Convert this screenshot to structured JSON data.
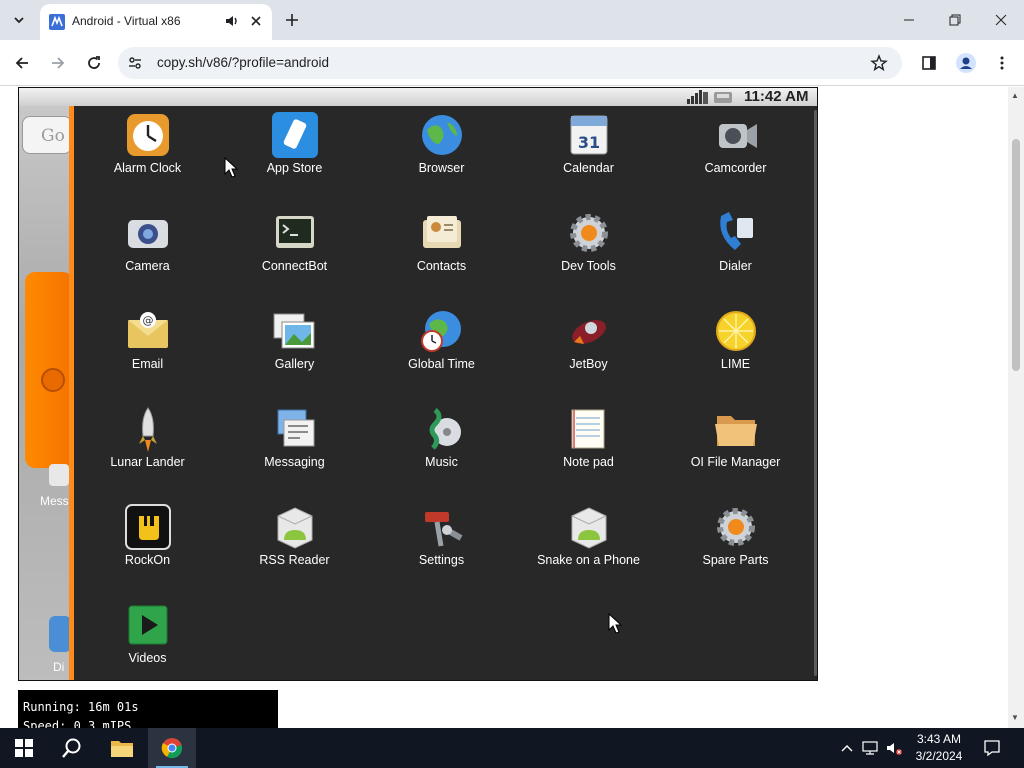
{
  "browser": {
    "tab_title": "Android - Virtual x86",
    "url": "copy.sh/v86/?profile=android"
  },
  "android": {
    "status_time": "11:42 AM",
    "home_search_hint": "Go",
    "home_label_messaging": "Mess",
    "home_label_dialer": "Di"
  },
  "apps": [
    {
      "label": "Alarm Clock",
      "icon": "alarm-clock-icon"
    },
    {
      "label": "App Store",
      "icon": "app-store-icon"
    },
    {
      "label": "Browser",
      "icon": "browser-globe-icon"
    },
    {
      "label": "Calendar",
      "icon": "calendar-icon"
    },
    {
      "label": "Camcorder",
      "icon": "camcorder-icon"
    },
    {
      "label": "Camera",
      "icon": "camera-icon"
    },
    {
      "label": "ConnectBot",
      "icon": "terminal-icon"
    },
    {
      "label": "Contacts",
      "icon": "contacts-icon"
    },
    {
      "label": "Dev Tools",
      "icon": "gear-icon"
    },
    {
      "label": "Dialer",
      "icon": "phone-icon"
    },
    {
      "label": "Email",
      "icon": "email-icon"
    },
    {
      "label": "Gallery",
      "icon": "gallery-icon"
    },
    {
      "label": "Global Time",
      "icon": "globe-clock-icon"
    },
    {
      "label": "JetBoy",
      "icon": "jetboy-icon"
    },
    {
      "label": "LIME",
      "icon": "lemon-icon"
    },
    {
      "label": "Lunar Lander",
      "icon": "rocket-icon"
    },
    {
      "label": "Messaging",
      "icon": "messaging-icon"
    },
    {
      "label": "Music",
      "icon": "music-icon"
    },
    {
      "label": "Note pad",
      "icon": "notepad-icon"
    },
    {
      "label": "OI File Manager",
      "icon": "folder-icon"
    },
    {
      "label": "RockOn",
      "icon": "rockon-icon"
    },
    {
      "label": "RSS Reader",
      "icon": "android-box-icon"
    },
    {
      "label": "Settings",
      "icon": "settings-icon"
    },
    {
      "label": "Snake on a Phone",
      "icon": "android-box-icon"
    },
    {
      "label": "Spare Parts",
      "icon": "gear-icon"
    },
    {
      "label": "Videos",
      "icon": "video-play-icon"
    }
  ],
  "emulator": {
    "running": "Running: 16m 01s",
    "speed": "Speed: 0.3 mIPS"
  },
  "taskbar": {
    "time": "3:43 AM",
    "date": "3/2/2024"
  },
  "colors": {
    "drawer_bg": "#282828",
    "drawer_accent": "#ff8c1a",
    "taskbar_bg": "#101722",
    "tab_strip": "#dee3ea"
  }
}
